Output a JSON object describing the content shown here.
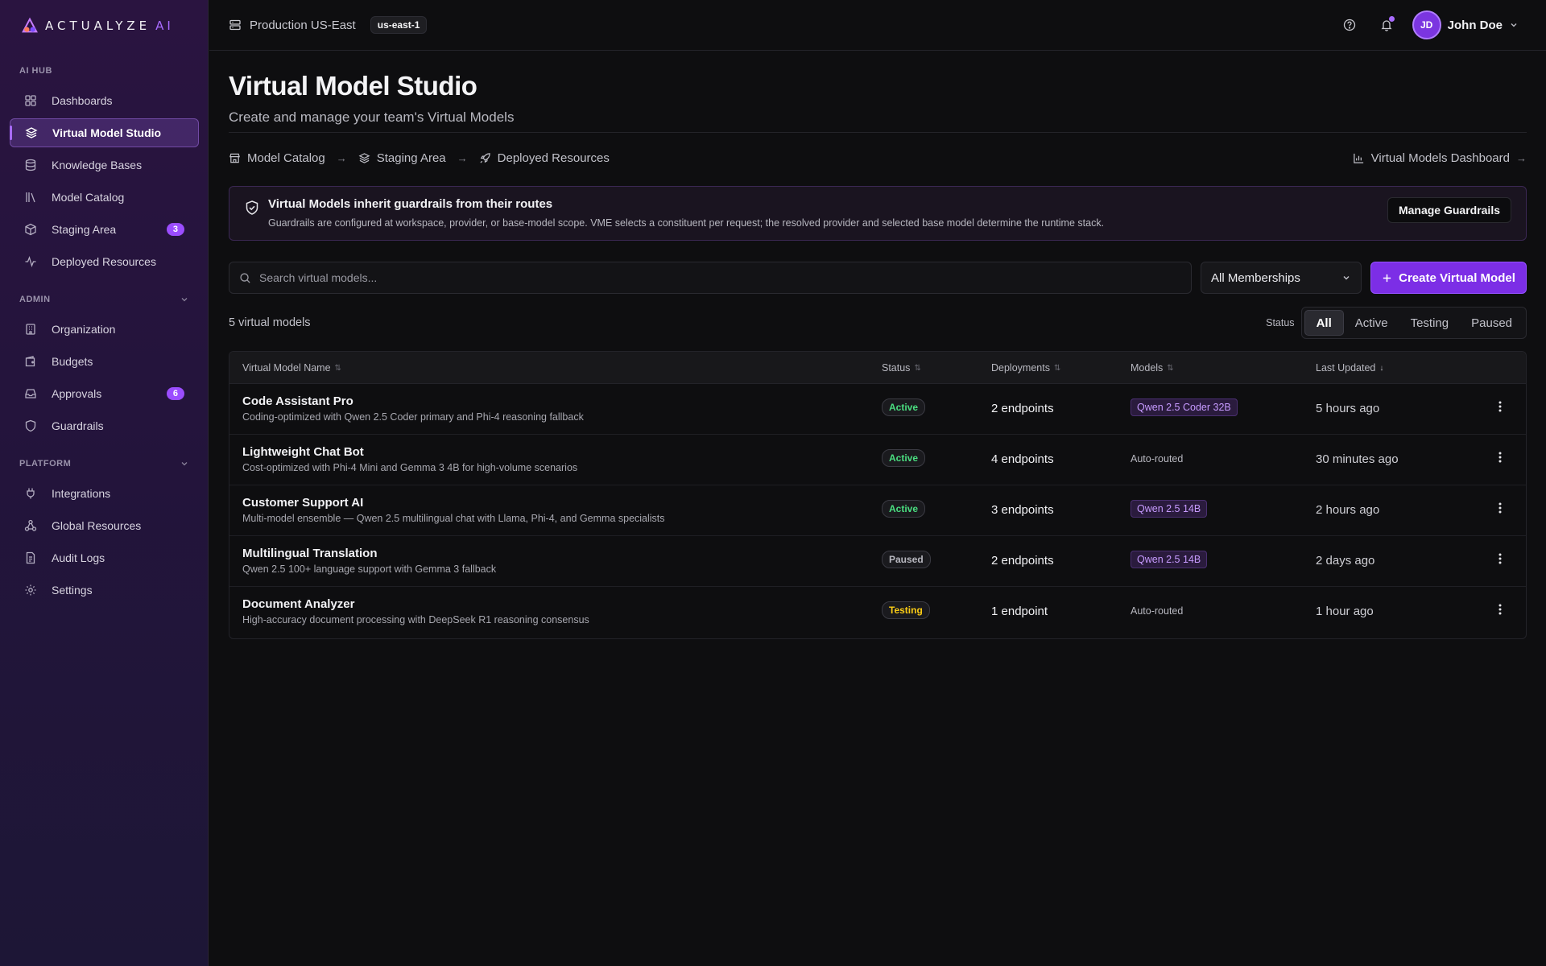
{
  "brand": {
    "name": "ACTUALYZE",
    "suffix": "AI"
  },
  "sidebar": {
    "sections": [
      {
        "label": "AI HUB"
      },
      {
        "label": "ADMIN"
      },
      {
        "label": "PLATFORM"
      }
    ],
    "items": [
      {
        "label": "Dashboards",
        "icon": "grid-icon"
      },
      {
        "label": "Virtual Model Studio",
        "icon": "layers-icon",
        "active": true
      },
      {
        "label": "Knowledge Bases",
        "icon": "database-icon"
      },
      {
        "label": "Model Catalog",
        "icon": "library-icon"
      },
      {
        "label": "Staging Area",
        "icon": "package-icon",
        "badge": "3"
      },
      {
        "label": "Deployed Resources",
        "icon": "activity-icon"
      },
      {
        "label": "Organization",
        "icon": "building-icon"
      },
      {
        "label": "Budgets",
        "icon": "wallet-icon"
      },
      {
        "label": "Approvals",
        "icon": "inbox-icon",
        "badge": "6"
      },
      {
        "label": "Guardrails",
        "icon": "shield-icon"
      },
      {
        "label": "Integrations",
        "icon": "plug-icon"
      },
      {
        "label": "Global Resources",
        "icon": "network-icon"
      },
      {
        "label": "Audit Logs",
        "icon": "file-text-icon"
      },
      {
        "label": "Settings",
        "icon": "gear-icon"
      }
    ]
  },
  "topbar": {
    "environment": "Production US-East",
    "region": "us-east-1",
    "user": {
      "initials": "JD",
      "name": "John Doe"
    }
  },
  "page": {
    "title": "Virtual Model Studio",
    "subtitle": "Create and manage your team's Virtual Models"
  },
  "breadcrumbs": [
    "Model Catalog",
    "Staging Area",
    "Deployed Resources"
  ],
  "dashboard_link": "Virtual Models Dashboard",
  "banner": {
    "title": "Virtual Models inherit guardrails from their routes",
    "text": "Guardrails are configured at workspace, provider, or base-model scope. VME selects a constituent per request; the resolved provider and selected base model determine the runtime stack.",
    "button": "Manage Guardrails"
  },
  "search": {
    "placeholder": "Search virtual models..."
  },
  "membership_filter": {
    "selected": "All Memberships"
  },
  "create_button": "Create Virtual Model",
  "count_label": "5 virtual models",
  "status_filter": {
    "label": "Status",
    "options": [
      "All",
      "Active",
      "Testing",
      "Paused"
    ],
    "selected": "All"
  },
  "table": {
    "columns": [
      "Virtual Model Name",
      "Status",
      "Deployments",
      "Models",
      "Last Updated"
    ],
    "rows": [
      {
        "name": "Code Assistant Pro",
        "description": "Coding-optimized with Qwen 2.5 Coder primary and Phi-4 reasoning fallback",
        "status": "Active",
        "deployments": "2 endpoints",
        "model": "Qwen 2.5 Coder 32B",
        "updated": "5 hours ago"
      },
      {
        "name": "Lightweight Chat Bot",
        "description": "Cost-optimized with Phi-4 Mini and Gemma 3 4B for high-volume scenarios",
        "status": "Active",
        "deployments": "4 endpoints",
        "model": "Auto-routed",
        "updated": "30 minutes ago"
      },
      {
        "name": "Customer Support AI",
        "description": "Multi-model ensemble — Qwen 2.5 multilingual chat with Llama, Phi-4, and Gemma specialists",
        "status": "Active",
        "deployments": "3 endpoints",
        "model": "Qwen 2.5 14B",
        "updated": "2 hours ago"
      },
      {
        "name": "Multilingual Translation",
        "description": "Qwen 2.5 100+ language support with Gemma 3 fallback",
        "status": "Paused",
        "deployments": "2 endpoints",
        "model": "Qwen 2.5 14B",
        "updated": "2 days ago"
      },
      {
        "name": "Document Analyzer",
        "description": "High-accuracy document processing with DeepSeek R1 reasoning consensus",
        "status": "Testing",
        "deployments": "1 endpoint",
        "model": "Auto-routed",
        "updated": "1 hour ago"
      }
    ]
  },
  "colors": {
    "accent": "#7c2ee6",
    "active": "#4ade80",
    "testing": "#facc15",
    "sidebar": "#2a1440"
  }
}
